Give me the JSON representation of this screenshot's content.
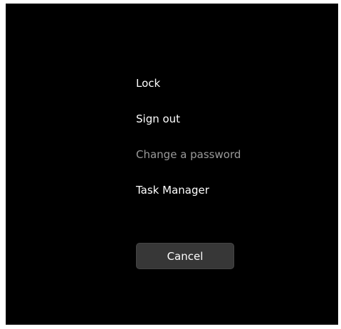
{
  "security_options": {
    "items": [
      {
        "label": "Lock",
        "enabled": true
      },
      {
        "label": "Sign out",
        "enabled": true
      },
      {
        "label": "Change a password",
        "enabled": true,
        "dimmed": true
      },
      {
        "label": "Task Manager",
        "enabled": true
      }
    ],
    "cancel_label": "Cancel"
  },
  "colors": {
    "background": "#000000",
    "text": "#ffffff",
    "dim_text": "#9a9a9a",
    "button_background": "#373737"
  }
}
